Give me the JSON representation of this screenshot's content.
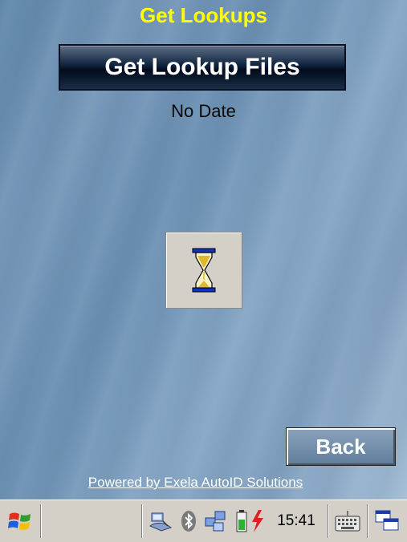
{
  "header": {
    "title": "Get Lookups"
  },
  "main": {
    "get_files_label": "Get Lookup Files",
    "date_status": "No Date",
    "busy_icon": "hourglass-icon"
  },
  "footer": {
    "back_label": "Back",
    "powered_by": "Powered by Exela AutoID Solutions"
  },
  "taskbar": {
    "start_icon": "windows-flag-icon",
    "tray_icons": [
      "network-icon",
      "bluetooth-icon",
      "network-sync-icon",
      "battery-charging-icon"
    ],
    "clock": "15:41",
    "input_icon": "keyboard-icon",
    "switcher_icon": "window-switcher-icon"
  },
  "colors": {
    "title": "#ffff00",
    "main_button": "#0e223d",
    "back_button": "#5f7d9b",
    "taskbar": "#d4d0c8"
  }
}
